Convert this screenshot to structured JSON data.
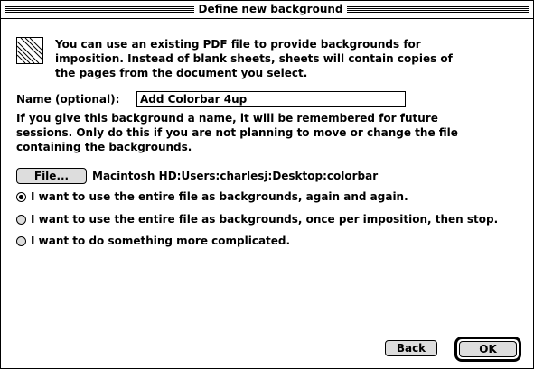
{
  "window": {
    "title": "Define new background"
  },
  "intro": {
    "line1": "You can use an existing PDF file to provide backgrounds for",
    "line2": "imposition. Instead of blank sheets, sheets will contain copies of",
    "line3": "the pages from the document you select."
  },
  "name_field": {
    "label": "Name (optional):",
    "value": "Add Colorbar 4up"
  },
  "explain": {
    "line1": "If you give this background a name, it will be remembered for future",
    "line2": "sessions. Only do this if you are not planning to move or change the file",
    "line3": "containing the backgrounds."
  },
  "file": {
    "button_label": "File...",
    "path": "Macintosh HD:Users:charlesj:Desktop:colorbar"
  },
  "options": [
    {
      "label": "I want to use the entire file as backgrounds, again and again.",
      "selected": true
    },
    {
      "label": "I want to use the entire file as backgrounds, once per imposition, then stop.",
      "selected": false
    },
    {
      "label": "I want to do something more complicated.",
      "selected": false
    }
  ],
  "buttons": {
    "back": "Back",
    "ok": "OK"
  },
  "icons": {
    "doc": "document-icon"
  }
}
